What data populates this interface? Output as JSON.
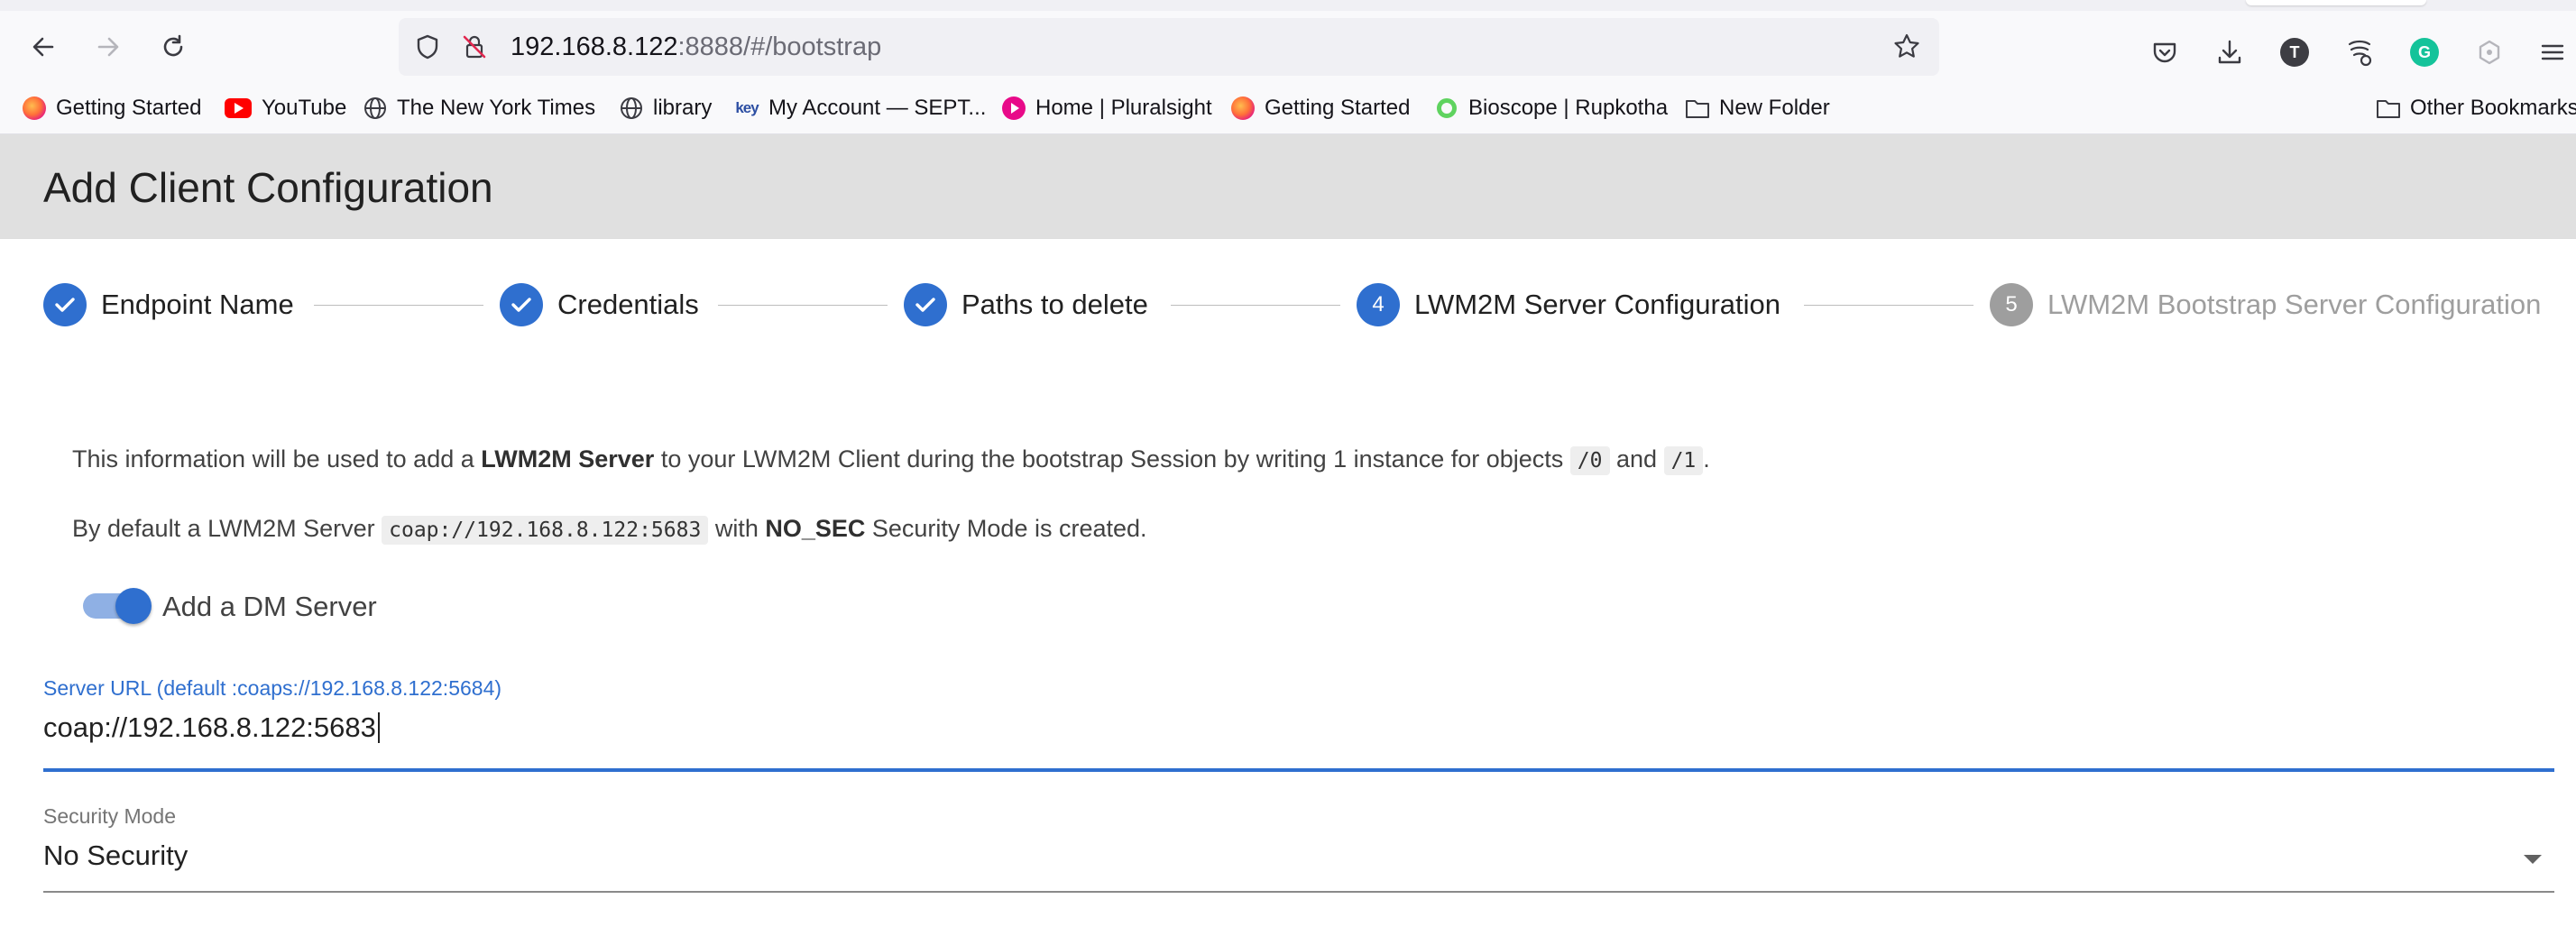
{
  "browser": {
    "url_host": "192.168.8.122",
    "url_rest": ":8888/#/bootstrap",
    "toolbar_icons": [
      "pocket-icon",
      "download-icon",
      "account-avatar-icon",
      "extension-icon",
      "grammarly-icon",
      "extensions-puzzle-icon",
      "menu-icon"
    ],
    "avatar_letter": "T",
    "grammarly_letter": "G",
    "bookmarks": [
      {
        "label": "Getting Started",
        "icon": "firefox-icon"
      },
      {
        "label": "YouTube",
        "icon": "youtube-icon"
      },
      {
        "label": "The New York Times",
        "icon": "globe-icon"
      },
      {
        "label": "library",
        "icon": "globe-icon"
      },
      {
        "label": "My Account — SEPT...",
        "icon": "key-icon"
      },
      {
        "label": "Home | Pluralsight",
        "icon": "pluralsight-icon"
      },
      {
        "label": "Getting Started",
        "icon": "firefox-icon"
      },
      {
        "label": "Bioscope | Rupkotha",
        "icon": "bioscope-icon"
      },
      {
        "label": "New Folder",
        "icon": "folder-icon"
      }
    ],
    "other_bookmarks": "Other Bookmarks",
    "key_logo_text": "key"
  },
  "page": {
    "title": "Add Client Configuration"
  },
  "stepper": {
    "steps": [
      {
        "label": "Endpoint Name",
        "state": "done"
      },
      {
        "label": "Credentials",
        "state": "done"
      },
      {
        "label": "Paths to delete",
        "state": "done"
      },
      {
        "label": "LWM2M Server Configuration",
        "state": "active",
        "number": "4"
      },
      {
        "label": "LWM2M Bootstrap Server Configuration",
        "state": "pending",
        "number": "5"
      }
    ]
  },
  "content": {
    "info1_a": "This information will be used to add a ",
    "info1_b": "LWM2M Server",
    "info1_c": " to your LWM2M Client during the bootstrap Session by writing 1 instance for objects ",
    "info1_code1": "/0",
    "info1_d": " and ",
    "info1_code2": "/1",
    "info1_e": ".",
    "info2_a": "By default a LWM2M Server ",
    "info2_code": "coap://192.168.8.122:5683",
    "info2_b": " with ",
    "info2_c": "NO_SEC",
    "info2_d": " Security Mode is created.",
    "toggle_label": "Add a DM Server",
    "toggle_on": true,
    "server_url_label": "Server URL (default :coaps://192.168.8.122:5684)",
    "server_url_value": "coap://192.168.8.122:5683",
    "security_mode_label": "Security Mode",
    "security_mode_value": "No Security"
  },
  "colors": {
    "primary": "#2f6fcf",
    "pending_step": "#9e9e9e",
    "header_bg": "#e0e0e0"
  }
}
